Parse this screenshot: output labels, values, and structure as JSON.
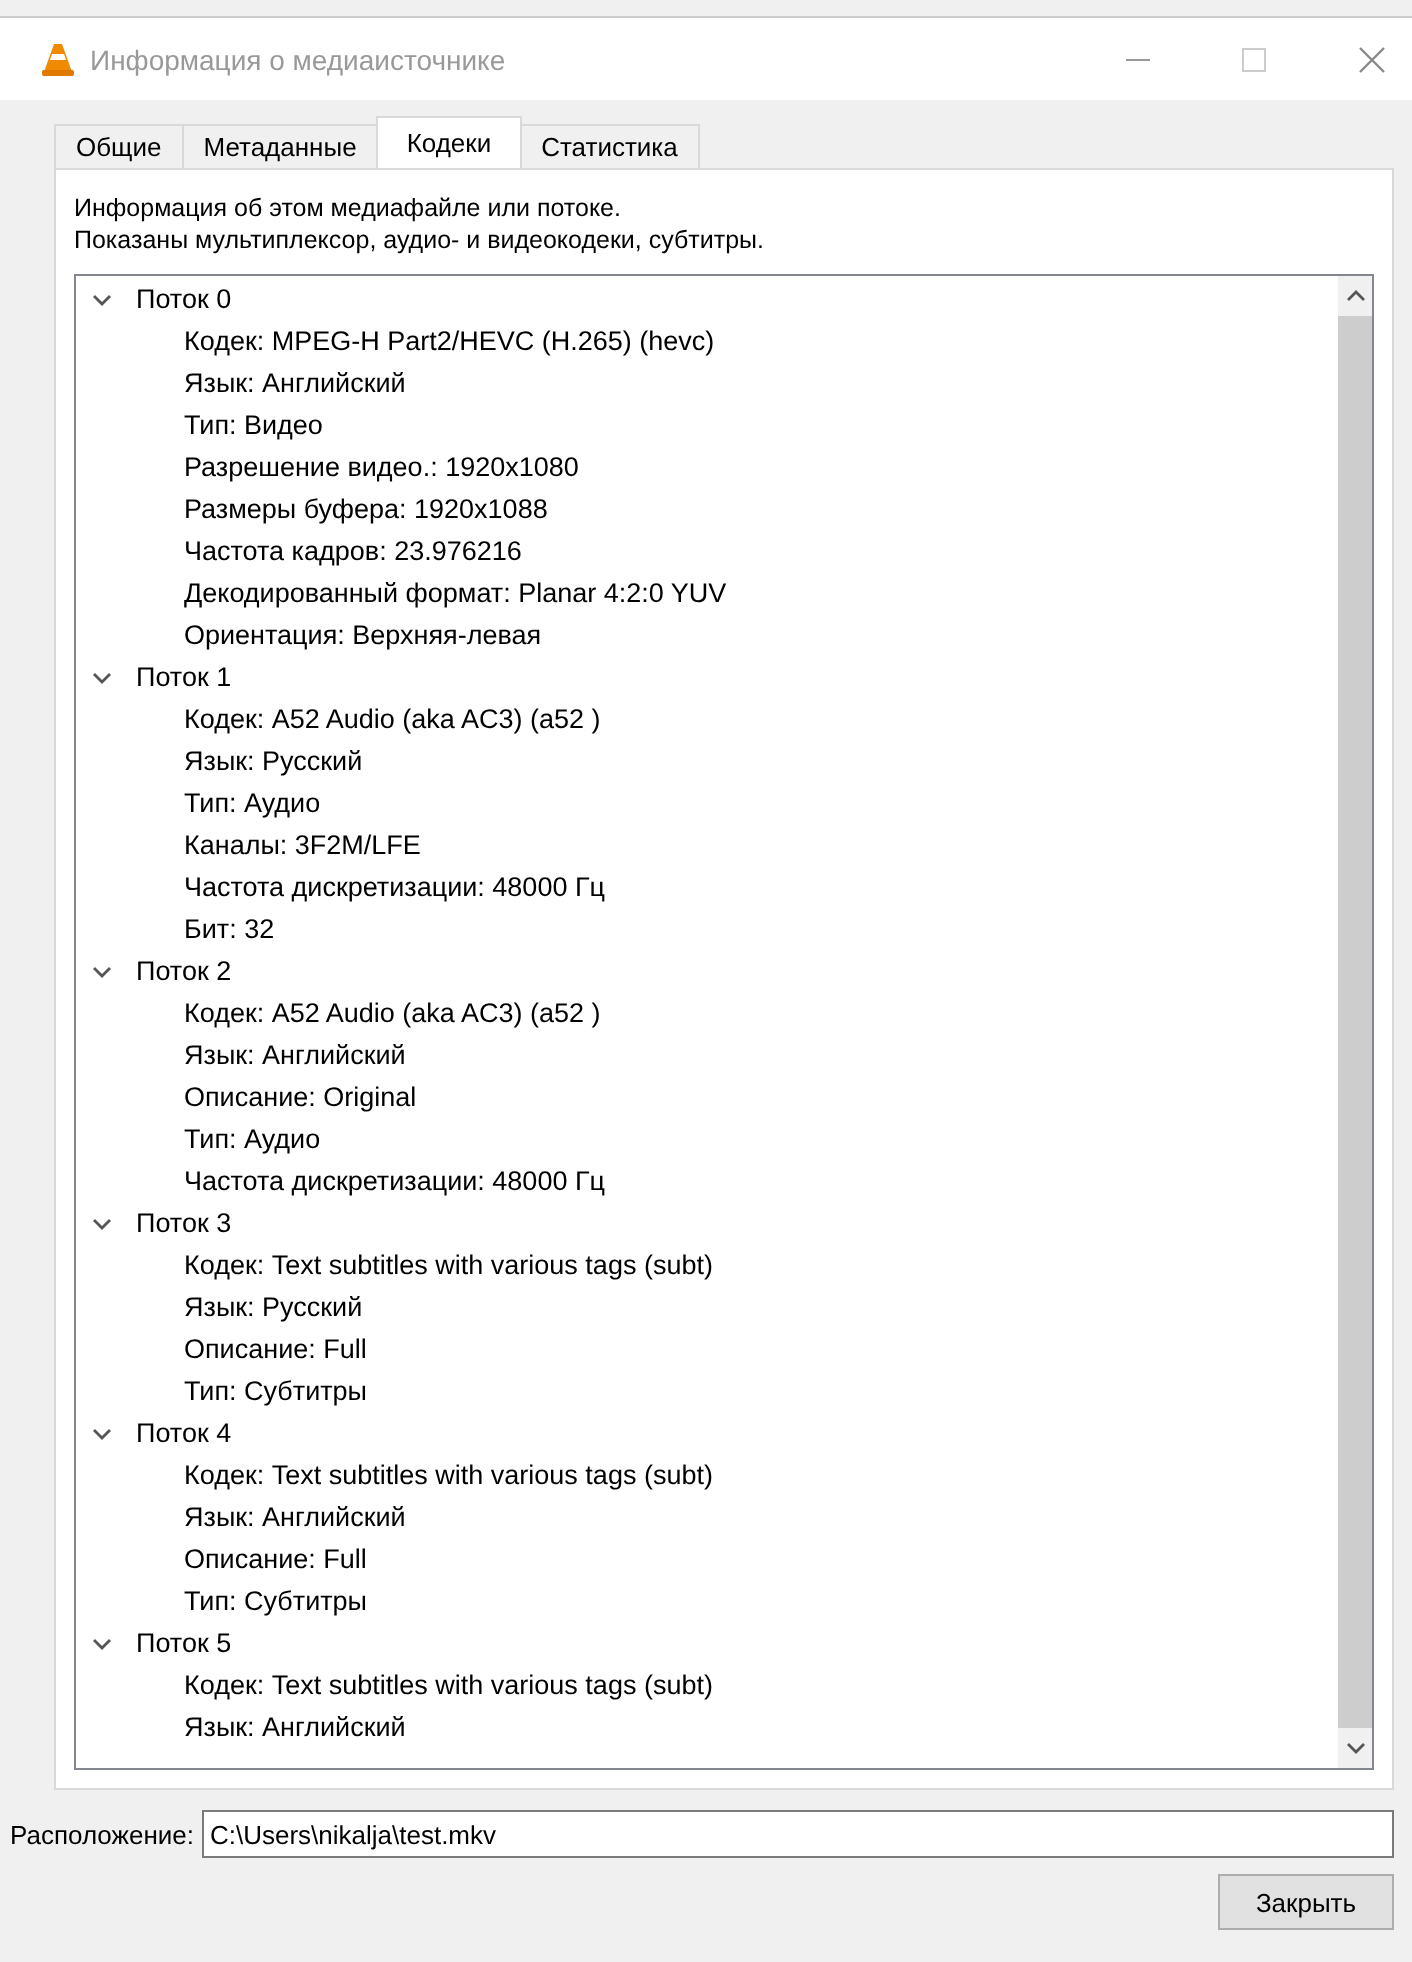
{
  "window": {
    "title": "Информация о медиаисточнике"
  },
  "tabs": [
    {
      "label": "Общие",
      "selected": false
    },
    {
      "label": "Метаданные",
      "selected": false
    },
    {
      "label": "Кодеки",
      "selected": true
    },
    {
      "label": "Статистика",
      "selected": false
    }
  ],
  "description": [
    "Информация об этом медиафайле или потоке.",
    "Показаны мультиплексор, аудио- и видеокодеки, субтитры."
  ],
  "streams": [
    {
      "label": "Поток 0",
      "expanded": true,
      "children": [
        "Кодек: MPEG-H Part2/HEVC (H.265) (hevc)",
        "Язык: Английский",
        "Тип: Видео",
        "Разрешение видео.: 1920x1080",
        "Размеры буфера: 1920x1088",
        "Частота кадров: 23.976216",
        "Декодированный формат: Planar 4:2:0 YUV",
        "Ориентация: Верхняя-левая"
      ]
    },
    {
      "label": "Поток 1",
      "expanded": true,
      "children": [
        "Кодек: A52 Audio (aka AC3) (a52 )",
        "Язык: Русский",
        "Тип: Аудио",
        "Каналы: 3F2M/LFE",
        "Частота дискретизации: 48000 Гц",
        "Бит: 32"
      ]
    },
    {
      "label": "Поток 2",
      "expanded": true,
      "children": [
        "Кодек: A52 Audio (aka AC3) (a52 )",
        "Язык: Английский",
        "Описание: Original",
        "Тип: Аудио",
        "Частота дискретизации: 48000 Гц"
      ]
    },
    {
      "label": "Поток 3",
      "expanded": true,
      "children": [
        "Кодек: Text subtitles with various tags (subt)",
        "Язык: Русский",
        "Описание: Full",
        "Тип: Субтитры"
      ]
    },
    {
      "label": "Поток 4",
      "expanded": true,
      "children": [
        "Кодек: Text subtitles with various tags (subt)",
        "Язык: Английский",
        "Описание: Full",
        "Тип: Субтитры"
      ]
    },
    {
      "label": "Поток 5",
      "expanded": true,
      "children": [
        "Кодек: Text subtitles with various tags (subt)",
        "Язык: Английский"
      ]
    }
  ],
  "location": {
    "label": "Расположение:",
    "value": "C:\\Users\\nikalja\\test.mkv"
  },
  "buttons": [
    "Закрыть"
  ]
}
